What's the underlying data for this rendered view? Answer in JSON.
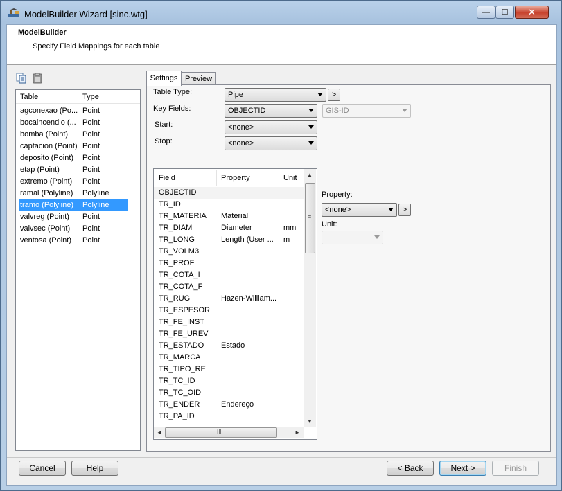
{
  "window": {
    "title": "ModelBuilder Wizard [sinc.wtg]",
    "controls": {
      "minimize": "—",
      "maximize": "☐",
      "close": "✕"
    }
  },
  "header": {
    "title": "ModelBuilder",
    "subtitle": "Specify Field Mappings for each table"
  },
  "toolbar": {
    "copy_icon": "copy-icon",
    "paste_icon": "paste-icon"
  },
  "table_list": {
    "columns": [
      "Table",
      "Type"
    ],
    "rows": [
      {
        "table": "agconexao (Po...",
        "type": "Point"
      },
      {
        "table": "bocaincendio (...",
        "type": "Point"
      },
      {
        "table": "bomba (Point)",
        "type": "Point"
      },
      {
        "table": "captacion (Point)",
        "type": "Point"
      },
      {
        "table": "deposito (Point)",
        "type": "Point"
      },
      {
        "table": "etap (Point)",
        "type": "Point"
      },
      {
        "table": "extremo (Point)",
        "type": "Point"
      },
      {
        "table": "ramal (Polyline)",
        "type": "Polyline"
      },
      {
        "table": "tramo (Polyline)",
        "type": "Polyline"
      },
      {
        "table": "valvreg (Point)",
        "type": "Point"
      },
      {
        "table": "valvsec (Point)",
        "type": "Point"
      },
      {
        "table": "ventosa (Point)",
        "type": "Point"
      }
    ],
    "selected_index": 8
  },
  "tabs": {
    "settings": "Settings",
    "preview": "Preview"
  },
  "settings": {
    "table_type_label": "Table Type:",
    "table_type_value": "Pipe",
    "key_fields_label": "Key Fields:",
    "key_fields_value": "OBJECTID",
    "key_fields_secondary": "GIS-ID",
    "start_label": "Start:",
    "start_value": "<none>",
    "stop_label": "Stop:",
    "stop_value": "<none>",
    "more_button": ">"
  },
  "field_grid": {
    "columns": [
      "Field",
      "Property",
      "Unit"
    ],
    "rows": [
      {
        "field": "OBJECTID",
        "property": "",
        "unit": ""
      },
      {
        "field": "TR_ID",
        "property": "",
        "unit": ""
      },
      {
        "field": "TR_MATERIA",
        "property": "Material",
        "unit": ""
      },
      {
        "field": "TR_DIAM",
        "property": "Diameter",
        "unit": "mm"
      },
      {
        "field": "TR_LONG",
        "property": "Length (User ...",
        "unit": "m"
      },
      {
        "field": "TR_VOLM3",
        "property": "",
        "unit": ""
      },
      {
        "field": "TR_PROF",
        "property": "",
        "unit": ""
      },
      {
        "field": "TR_COTA_I",
        "property": "",
        "unit": ""
      },
      {
        "field": "TR_COTA_F",
        "property": "",
        "unit": ""
      },
      {
        "field": "TR_RUG",
        "property": "Hazen-William...",
        "unit": ""
      },
      {
        "field": "TR_ESPESOR",
        "property": "",
        "unit": ""
      },
      {
        "field": "TR_FE_INST",
        "property": "",
        "unit": ""
      },
      {
        "field": "TR_FE_UREV",
        "property": "",
        "unit": ""
      },
      {
        "field": "TR_ESTADO",
        "property": "Estado",
        "unit": ""
      },
      {
        "field": "TR_MARCA",
        "property": "",
        "unit": ""
      },
      {
        "field": "TR_TIPO_RE",
        "property": "",
        "unit": ""
      },
      {
        "field": "TR_TC_ID",
        "property": "",
        "unit": ""
      },
      {
        "field": "TR_TC_OID",
        "property": "",
        "unit": ""
      },
      {
        "field": "TR_ENDER",
        "property": "Endereço",
        "unit": ""
      },
      {
        "field": "TR_PA_ID",
        "property": "",
        "unit": ""
      },
      {
        "field": "TR_PA_OID",
        "property": "",
        "unit": ""
      }
    ],
    "highlight_index": 0,
    "scroll_grip": "≡",
    "hscroll_grip": "III",
    "arrows": {
      "up": "▲",
      "down": "▼",
      "left": "◄",
      "right": "►"
    }
  },
  "property_panel": {
    "property_label": "Property:",
    "property_value": "<none>",
    "unit_label": "Unit:",
    "unit_value": "",
    "more_button": ">"
  },
  "buttons": {
    "cancel": "Cancel",
    "help": "Help",
    "back": "< Back",
    "next": "Next >",
    "finish": "Finish"
  }
}
